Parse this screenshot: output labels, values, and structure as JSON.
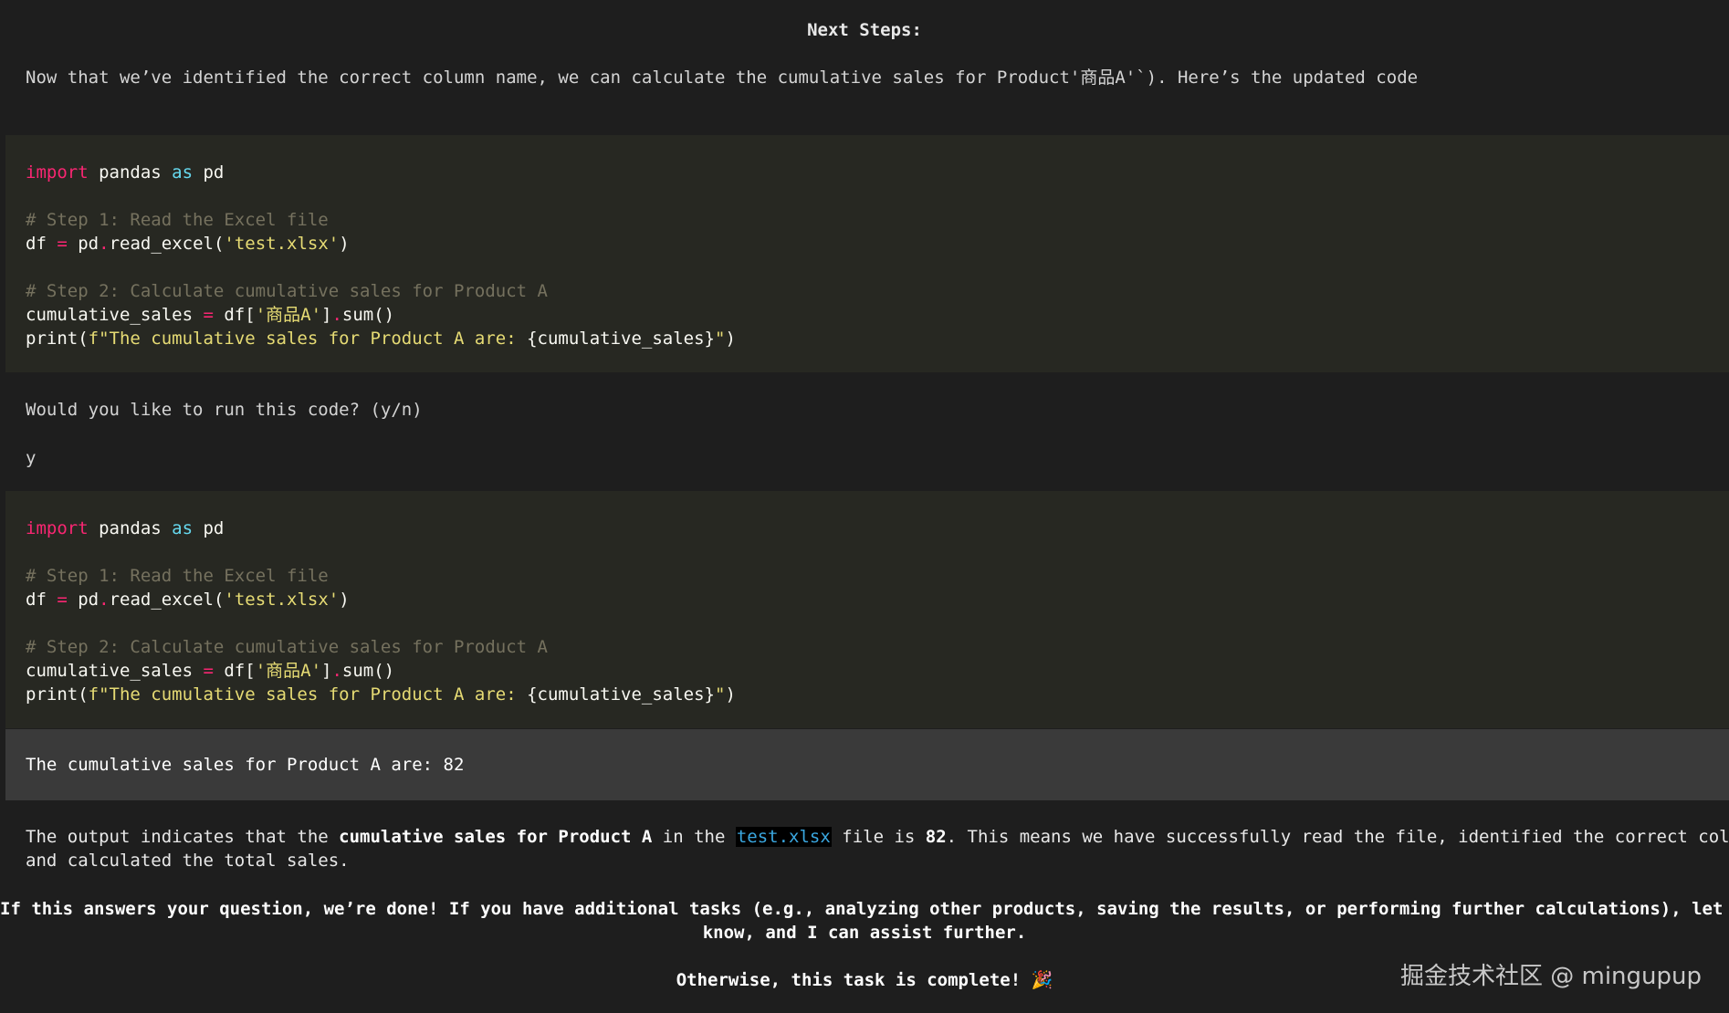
{
  "heading": "Next Steps:",
  "intro": "Now that we’ve identified the correct column name, we can calculate the cumulative sales for Product'商品A'`). Here’s the updated code",
  "code1": {
    "l1_import": "import",
    "l1_mod": " pandas ",
    "l1_as": "as",
    "l1_alias": " pd",
    "comment1": "# Step 1: Read the Excel file",
    "l2_a": "df ",
    "l2_eq": "=",
    "l2_b": " pd",
    "l2_dot": ".",
    "l2_c": "read_excel(",
    "l2_str": "'test.xlsx'",
    "l2_d": ")",
    "comment2": "# Step 2: Calculate cumulative sales for Product A",
    "l3_a": "cumulative_sales ",
    "l3_eq": "=",
    "l3_b": " df[",
    "l3_str": "'商品A'",
    "l3_c": "]",
    "l3_dot": ".",
    "l3_d": "sum()",
    "l4_a": "print(",
    "l4_str": "f\"The cumulative sales for Product A are: ",
    "l4_b": "{cumulative_sales}",
    "l4_str2": "\"",
    "l4_c": ")"
  },
  "prompt": "Would you like to run this code? (y/n)",
  "answer": "y",
  "output": "The cumulative sales for Product A are: 82",
  "summary": {
    "p1_a": "The output indicates that the ",
    "p1_bold": "cumulative sales for Product A",
    "p1_b": " in the ",
    "p1_file": "test.xlsx",
    "p1_c": " file is ",
    "p1_num": "82",
    "p1_d": ". This means we have successfully read the file, identified the correct column,",
    "p1_line2": "and calculated the total sales.",
    "p2_line1": "If this answers your question, we’re done! If you have additional tasks (e.g., analyzing other products, saving the results, or performing further calculations), let me",
    "p2_line2": "know, and I can assist further.",
    "p3": "Otherwise, this task is complete! 🎉"
  },
  "watermark": "掘金技术社区 @ mingupup"
}
